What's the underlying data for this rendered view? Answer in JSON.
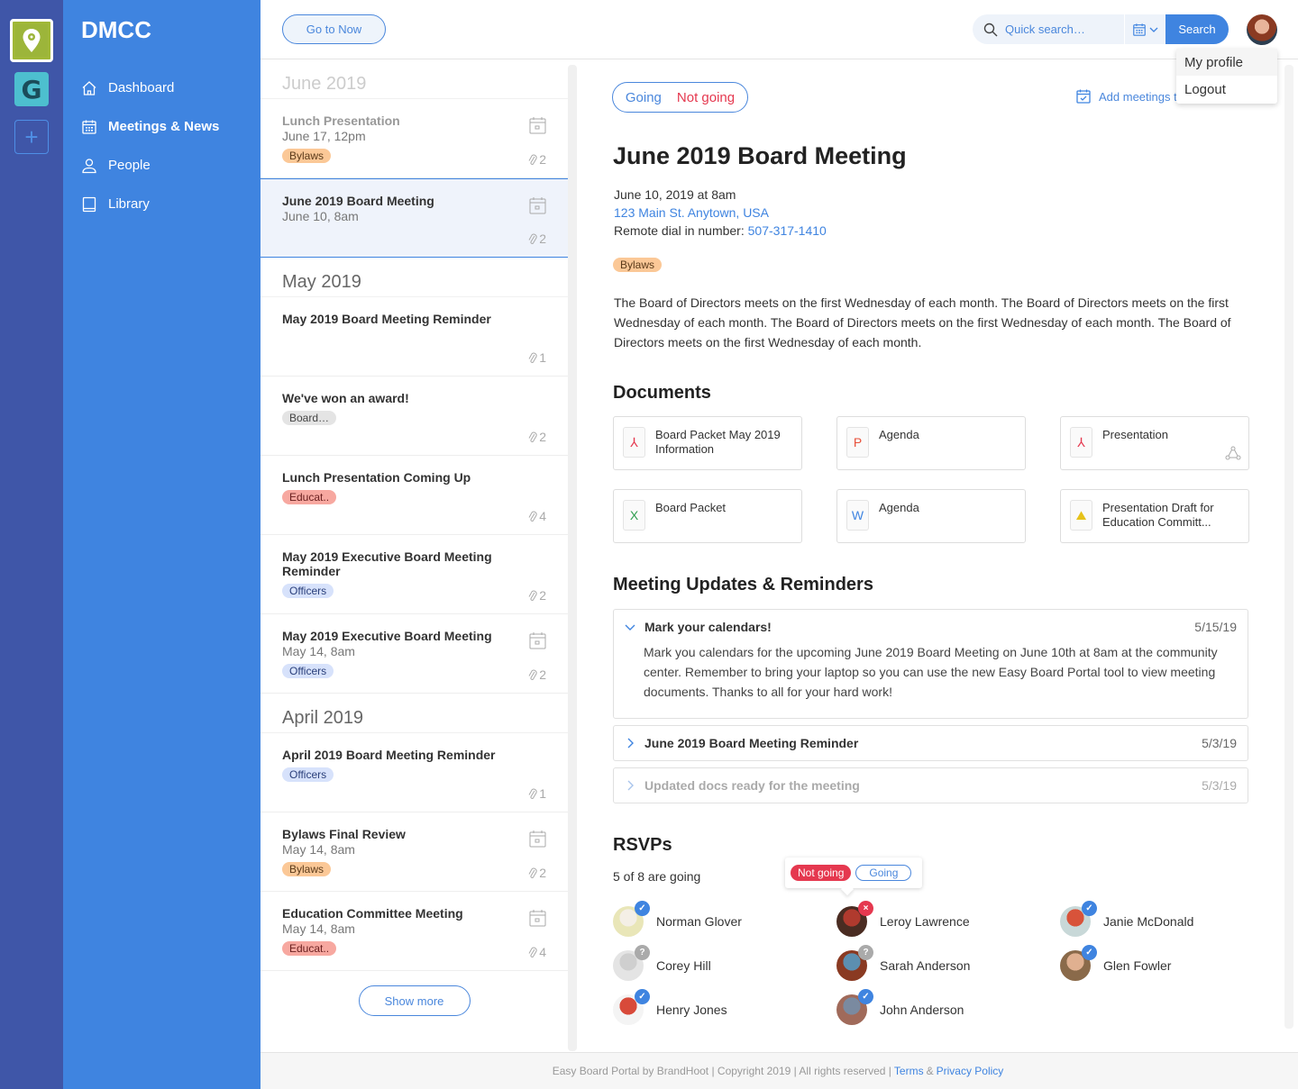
{
  "rail": {
    "orgs": [
      {
        "name": "DMCC",
        "icon": "map-pin-logo"
      },
      {
        "name": "G",
        "icon": "g-flame-logo"
      }
    ],
    "add_label": "+"
  },
  "sidebar": {
    "brand": "DMCC",
    "items": [
      {
        "label": "Dashboard",
        "icon": "home-icon",
        "active": false
      },
      {
        "label": "Meetings & News",
        "icon": "calendar-icon",
        "active": true
      },
      {
        "label": "People",
        "icon": "person-icon",
        "active": false
      },
      {
        "label": "Library",
        "icon": "book-icon",
        "active": false
      }
    ]
  },
  "topbar": {
    "goto_label": "Go to Now",
    "search_placeholder": "Quick search…",
    "search_button": "Search",
    "profile_menu": [
      "My profile",
      "Logout"
    ]
  },
  "list": {
    "groups": [
      {
        "month": "June 2019",
        "faded": true,
        "items": [
          {
            "title": "Lunch Presentation",
            "date": "June 17, 12pm",
            "tag": "Bylaws",
            "tag_type": "bylaws",
            "attachments": "2",
            "calendar": true,
            "faded": true
          },
          {
            "title": "June 2019 Board Meeting",
            "date": "June 10, 8am",
            "tag": "",
            "tag_type": "",
            "attachments": "2",
            "calendar": true,
            "selected": true
          }
        ]
      },
      {
        "month": "May 2019",
        "items": [
          {
            "title": "May 2019 Board Meeting Reminder",
            "date": "",
            "tag": "",
            "attachments": "1",
            "calendar": false
          },
          {
            "title": "We've won an award!",
            "date": "",
            "tag": "Board…",
            "tag_type": "board",
            "attachments": "2",
            "calendar": false
          },
          {
            "title": "Lunch Presentation Coming Up",
            "date": "",
            "tag": "Educat..",
            "tag_type": "educ",
            "attachments": "4",
            "calendar": false
          },
          {
            "title": "May 2019 Executive Board Meeting Reminder",
            "date": "",
            "tag": "Officers",
            "tag_type": "officers",
            "attachments": "2",
            "calendar": false
          },
          {
            "title": "May 2019 Executive Board Meeting",
            "date": "May 14, 8am",
            "tag": "Officers",
            "tag_type": "officers",
            "attachments": "2",
            "calendar": true
          }
        ]
      },
      {
        "month": "April 2019",
        "items": [
          {
            "title": "April 2019 Board Meeting Reminder",
            "date": "",
            "tag": "Officers",
            "tag_type": "officers",
            "attachments": "1",
            "calendar": false
          },
          {
            "title": "Bylaws Final Review",
            "date": "May 14, 8am",
            "tag": "Bylaws",
            "tag_type": "bylaws",
            "attachments": "2",
            "calendar": true
          },
          {
            "title": "Education Committee Meeting",
            "date": "May 14, 8am",
            "tag": "Educat..",
            "tag_type": "educ",
            "attachments": "4",
            "calendar": true
          }
        ]
      }
    ],
    "show_more": "Show more"
  },
  "meeting": {
    "rsvp_going": "Going",
    "rsvp_not_going": "Not going",
    "add_calendar": "Add meetings to",
    "title": "June 2019 Board Meeting",
    "datetime": "June 10, 2019 at 8am",
    "address": "123 Main St. Anytown, USA",
    "dial_label": "Remote dial in number: ",
    "dial_number": "507-317-1410",
    "tag": "Bylaws",
    "description": "The Board of Directors meets on the first Wednesday of each month.  The Board of Directors meets on the first Wednesday of each month.  The Board of Directors meets on the first Wednesday of each month. The Board of Directors meets on the first Wednesday of each month.",
    "documents_heading": "Documents",
    "documents": [
      {
        "name": "Board Packet May 2019 Information",
        "type": "pdf",
        "glyph": "⅄",
        "color": "#e5384f",
        "shared": false
      },
      {
        "name": "Agenda",
        "type": "powerpoint",
        "glyph": "P",
        "color": "#e8503a",
        "shared": false
      },
      {
        "name": "Presentation",
        "type": "pdf",
        "glyph": "⅄",
        "color": "#e5384f",
        "shared": true
      },
      {
        "name": "Board Packet",
        "type": "excel",
        "glyph": "X",
        "color": "#2e9e4f",
        "shared": false
      },
      {
        "name": "Agenda",
        "type": "word",
        "glyph": "W",
        "color": "#3f84e0",
        "shared": false
      },
      {
        "name": "Presentation Draft for Education Committ...",
        "type": "image",
        "glyph": "⛰",
        "color": "#e6c21a",
        "shared": false
      }
    ],
    "updates_heading": "Meeting Updates & Reminders",
    "updates": [
      {
        "title": "Mark your calendars!",
        "date": "5/15/19",
        "expanded": true,
        "body": "Mark you calendars for the upcoming June 2019 Board Meeting on June 10th at 8am at the community center. Remember to bring your laptop so you can use the new Easy Board Portal tool to view meeting documents. Thanks to all for your hard work!"
      },
      {
        "title": "June 2019 Board Meeting Reminder",
        "date": "5/3/19",
        "expanded": false
      },
      {
        "title": "Updated docs ready for the meeting",
        "date": "5/3/19",
        "expanded": false,
        "faded": true
      }
    ],
    "rsvps_heading": "RSVPs",
    "rsvp_count": "5 of 8 are going",
    "popup_not_going": "Not going",
    "popup_going": "Going",
    "people": [
      {
        "name": "Norman Glover",
        "status": "going",
        "avatar_colors": [
          "#e9e6b8",
          "#f4efe6"
        ]
      },
      {
        "name": "Leroy Lawrence",
        "status": "not-going",
        "avatar_colors": [
          "#4a2c22",
          "#b03a2e"
        ]
      },
      {
        "name": "Janie McDonald",
        "status": "going",
        "avatar_colors": [
          "#c8d8d8",
          "#d8533a"
        ]
      },
      {
        "name": "Corey Hill",
        "status": "unknown",
        "avatar_colors": [
          "#e4e4e4",
          "#cfcfcf"
        ]
      },
      {
        "name": "Sarah Anderson",
        "status": "unknown",
        "avatar_colors": [
          "#8a3a22",
          "#5c8fb0"
        ]
      },
      {
        "name": "Glen Fowler",
        "status": "going",
        "avatar_colors": [
          "#8a6a4a",
          "#e0b090"
        ]
      },
      {
        "name": "Henry Jones",
        "status": "going",
        "avatar_colors": [
          "#f4f4f4",
          "#d84a3a"
        ]
      },
      {
        "name": "John Anderson",
        "status": "going",
        "avatar_colors": [
          "#a06a5a",
          "#7a8aa0"
        ]
      }
    ]
  },
  "footer": {
    "text": "Easy Board Portal by BrandHoot | Copyright 2019 | All rights reserved |",
    "terms": "Terms",
    "amp": "&",
    "privacy": "Privacy Policy"
  }
}
